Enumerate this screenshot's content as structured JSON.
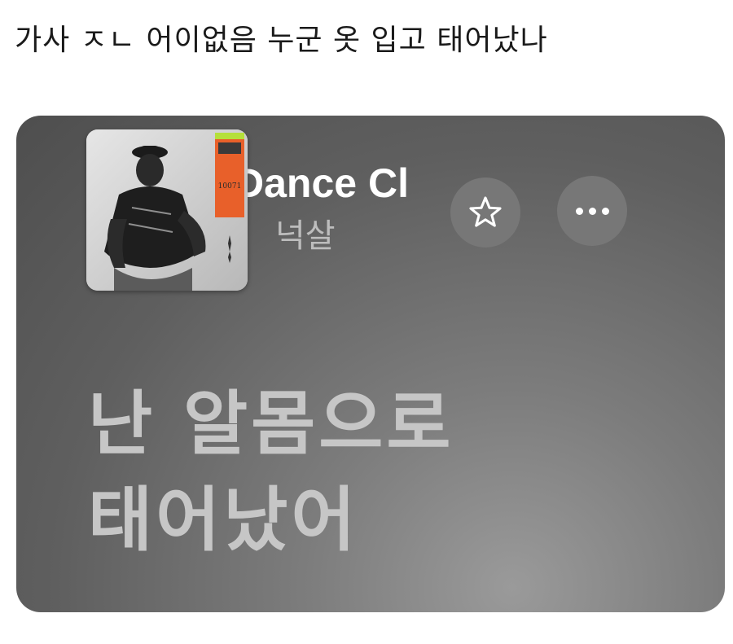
{
  "post": {
    "caption": "가사 ㅈㄴ 어이없음 누군 옷 입고 태어났나"
  },
  "player": {
    "song_title": "Dance Cl",
    "artist": "넉살",
    "star_icon": "star-outline-icon",
    "more_icon": "ellipsis-icon",
    "album_art_label": "10071"
  },
  "lyrics": {
    "line1": "난 알몸으로",
    "line2": "태어났어"
  }
}
